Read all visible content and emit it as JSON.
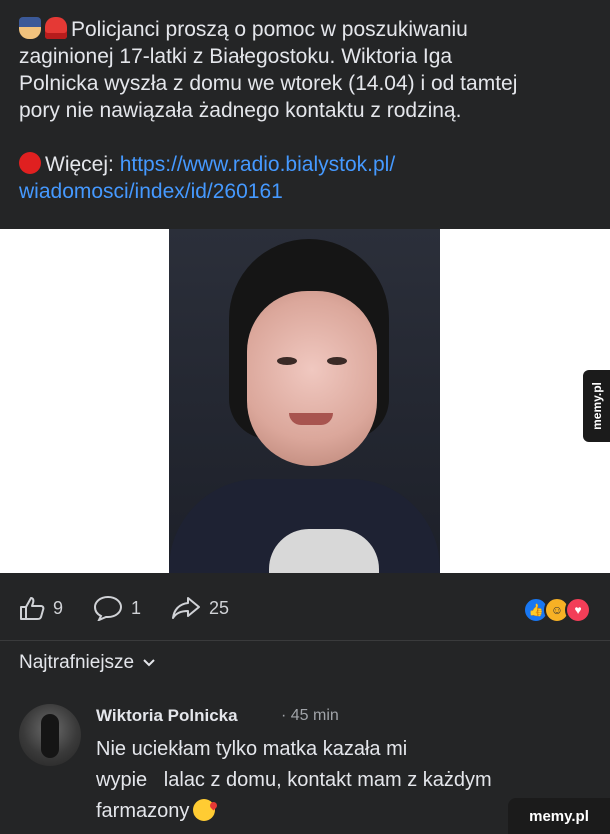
{
  "post": {
    "line1": "Policjanci proszą o pomoc w poszukiwaniu",
    "line2": "zaginionej 17-latki z Białegostoku. Wiktoria Iga",
    "line3": "Polnicka wyszła z domu we wtorek (14.04) i od tamtej",
    "line4": "pory nie nawiązała żadnego kontaktu z rodziną.",
    "more_label": "Więcej:",
    "link_line1": "https://www.radio.bialystok.pl/",
    "link_line2": "wiadomosci/index/id/260161",
    "icons": [
      "police-officer-emoji",
      "siren-emoji",
      "red-circle-emoji"
    ]
  },
  "actions": {
    "likes": "9",
    "comments": "1",
    "shares": "25",
    "reaction_icons": [
      "like",
      "care",
      "love"
    ]
  },
  "sort": {
    "label": "Najtrafniejsze"
  },
  "comment": {
    "author": "Wiktoria Polnicka",
    "time": "· 45 min",
    "line1": "Nie uciekłam tylko matka kazała mi",
    "line2": "wypie   lalac z domu, kontakt mam z każdym",
    "line3": "farmazony"
  },
  "watermark": {
    "side": "memy.pl",
    "bottom": "memy.pl"
  }
}
